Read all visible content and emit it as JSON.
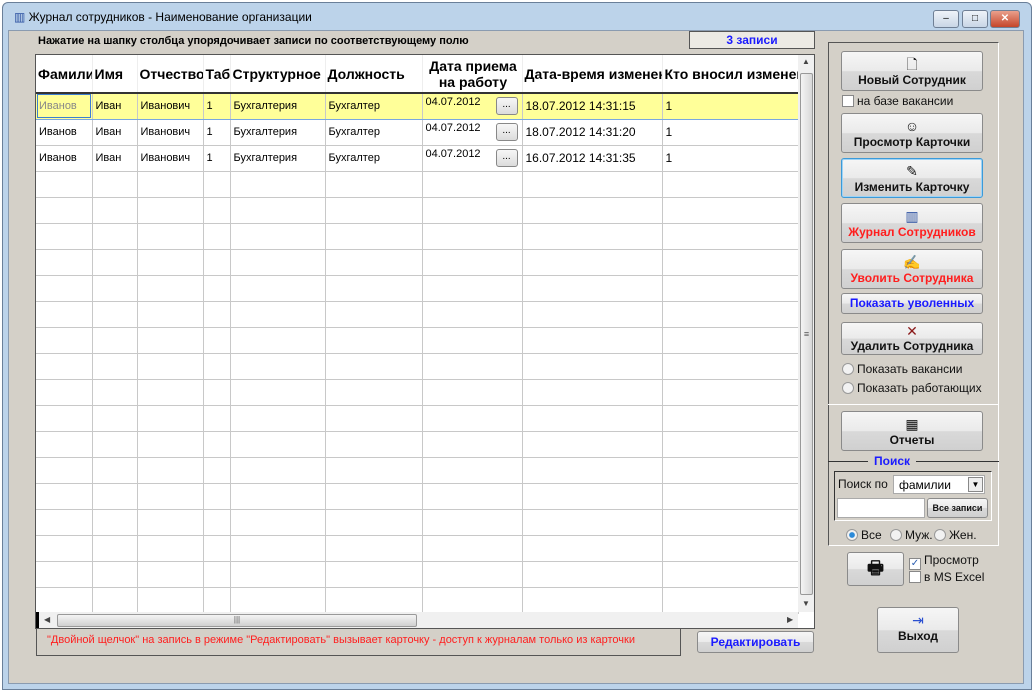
{
  "window": {
    "title": "Журнал сотрудников -  Наименование организации",
    "minimize": "–",
    "maximize": "□",
    "close": "✕"
  },
  "hint": "Нажатие на шапку столбца упорядочивает записи  по соответствующему полю",
  "record_count": "3 записи",
  "grid": {
    "columns": [
      "Фамилия",
      "Имя",
      "Отчество",
      "Таб",
      "Структурное",
      "Должность",
      "Дата приема на работу",
      "Дата-время изменения",
      "Кто вносил изменения"
    ],
    "rows": [
      [
        "Иванов",
        "Иван",
        "Иванович",
        "1",
        "Бухгалтерия",
        "Бухгалтер",
        "04.07.2012",
        "18.07.2012 14:31:15",
        "1"
      ],
      [
        "Иванов",
        "Иван",
        "Иванович",
        "1",
        "Бухгалтерия",
        "Бухгалтер",
        "04.07.2012",
        "18.07.2012 14:31:20",
        "1"
      ],
      [
        "Иванов",
        "Иван",
        "Иванович",
        "1",
        "Бухгалтерия",
        "Бухгалтер",
        "04.07.2012",
        "16.07.2012 14:31:35",
        "1"
      ]
    ],
    "picker_label": "...",
    "selected_row": 0
  },
  "note": "\"Двойной щелчок\" на запись в режиме \"Редактировать\" вызывает карточку  -  доступ к журналам только из карточки",
  "edit_button": "Редактировать",
  "panel": {
    "new_employee": "Новый Сотрудник",
    "from_vacancy": "на базе вакансии",
    "view_card": "Просмотр Карточки",
    "edit_card": "Изменить Карточку",
    "journal": "Журнал Сотрудников",
    "dismiss": "Уволить Сотрудника",
    "show_dismissed": "Показать уволенных",
    "delete": "Удалить Сотрудника",
    "show_vacancies": "Показать вакансии",
    "show_working": "Показать работающих",
    "reports": "Отчеты",
    "search_title": "Поиск",
    "search_by": "Поиск по",
    "search_field": "фамилии",
    "all_records": "Все записи",
    "gender_all": "Все",
    "gender_male": "Муж.",
    "gender_female": "Жен.",
    "preview": "Просмотр",
    "excel": "в MS Excel",
    "exit": "Выход"
  },
  "colors": {
    "accent_red": "#ff1e1e",
    "accent_blue": "#1a1aff",
    "selected_row": "#ffff99"
  }
}
